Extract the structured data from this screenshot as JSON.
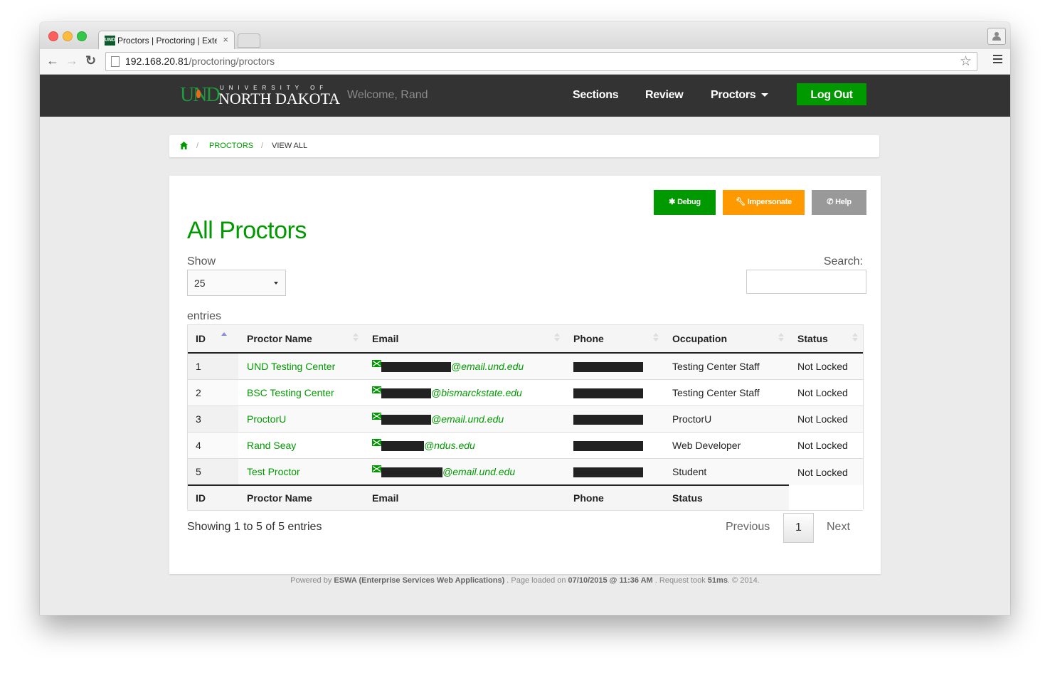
{
  "browser": {
    "tab_title": "Proctors | Proctoring | Exte",
    "tab_favicon_text": "UND",
    "url_host": "192.168.20.81",
    "url_path": "/proctoring/proctors"
  },
  "navbar": {
    "logo_und": "UND",
    "logo_university_of": "UNIVERSITY OF",
    "logo_north_dakota": "NORTH DAKOTA",
    "welcome": "Welcome, Rand",
    "links": [
      "Sections",
      "Review",
      "Proctors"
    ],
    "logout_label": "Log Out"
  },
  "breadcrumb": {
    "sep": "/",
    "items": [
      "PROCTORS",
      "VIEW ALL"
    ]
  },
  "actions": {
    "debug_label": "Debug",
    "impersonate_label": "Impersonate",
    "help_label": "Help"
  },
  "page": {
    "title": "All Proctors",
    "show_label": "Show",
    "length_value": "25",
    "entries_label": "entries",
    "search_label": "Search:",
    "search_value": ""
  },
  "table": {
    "columns": [
      "ID",
      "Proctor Name",
      "Email",
      "Phone",
      "Occupation",
      "Status"
    ],
    "footer_columns": [
      "ID",
      "Proctor Name",
      "Email",
      "Phone",
      "Status"
    ],
    "rows": [
      {
        "id": "1",
        "name": "UND Testing Center",
        "email_domain": "@email.und.edu",
        "occupation": "Testing Center Staff",
        "status": "Not Locked"
      },
      {
        "id": "2",
        "name": "BSC Testing Center",
        "email_domain": "@bismarckstate.edu",
        "occupation": "Testing Center Staff",
        "status": "Not Locked"
      },
      {
        "id": "3",
        "name": "ProctorU",
        "email_domain": "@email.und.edu",
        "occupation": "ProctorU",
        "status": "Not Locked"
      },
      {
        "id": "4",
        "name": "Rand Seay",
        "email_domain": "@ndus.edu",
        "occupation": "Web Developer",
        "status": "Not Locked"
      },
      {
        "id": "5",
        "name": "Test Proctor",
        "email_domain": "@email.und.edu",
        "occupation": "Student",
        "status": "Not Locked"
      }
    ]
  },
  "pagination": {
    "info": "Showing 1 to 5 of 5 entries",
    "previous": "Previous",
    "current": "1",
    "next": "Next"
  },
  "footer": {
    "powered_by": "Powered by",
    "org": "ESWA (Enterprise Services Web Applications)",
    "loaded_on": ". Page loaded on",
    "timestamp": "07/10/2015 @ 11:36 AM",
    "request_took": ". Request took",
    "duration": "51ms",
    "copyright": ". © 2014."
  },
  "colors": {
    "brand_green": "#009900",
    "impersonate_orange": "#ff9900",
    "help_gray": "#999999",
    "navbar_bg": "#333333"
  }
}
